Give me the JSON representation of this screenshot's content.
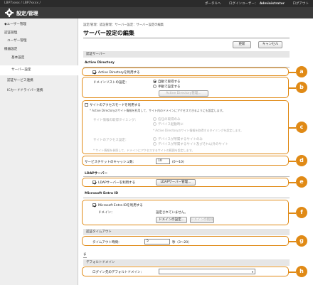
{
  "header": {
    "model": "LBP7xxxx / LBP7xxxx /",
    "links": [
      "ポータルへ",
      "ログインユーザー：",
      "Administrator",
      "ログアウト"
    ],
    "app_title": "設定/管理"
  },
  "sidebar": {
    "items": [
      {
        "label": "◆ユーザー管理"
      },
      {
        "label": "認証管理"
      },
      {
        "label": "ユーザー管理"
      },
      {
        "label": "機器設定"
      },
      {
        "label": "基本設定"
      },
      {
        "label": "サーバー設定"
      },
      {
        "label": "認証サービス連携"
      },
      {
        "label": "ICカードドライバー連携"
      }
    ]
  },
  "main": {
    "breadcrumb": "設定/管理：認証管理：サーバー設定：サーバー設定の編集",
    "page_title": "サーバー設定の編集",
    "update_button": "更新",
    "cancel_button": "キャンセル",
    "auth_server_header": "認証サーバー",
    "ad": {
      "title": "Active Directory",
      "use_ad": "Active Directoryを利用する",
      "domain_list_label": "ドメインリストの設定：",
      "auto_get": "自動で取得する",
      "manual": "手動で設定する",
      "ad_manage_button": "Active Directory管理...",
      "site_access_mode": "サイトのアクセスモードを利用する",
      "site_access_note": "* Active Directoryのサイト情報を利用して、サイト内のドメインにアクセスできるようにも設定します。",
      "site_info_timing_label": "サイト情報の取得タイミング：",
      "timing_opt1": "信任の取得のみ",
      "timing_opt2": "デバイス起動時に",
      "timing_note": "* Active Directoryのサイト情報を取得するタイミングを設定します。",
      "site_access_setting_label": "サイトのアクセス設定：",
      "access_opt1": "デバイスが所属するサイトのみ",
      "access_opt2": "デバイスが所属するサイト及びそれ以外のサイト",
      "access_note": "* サイト情報を参照して、ドメインにアクセスするサイトの範囲を設定します。",
      "ticket_cache_label": "サービスチケットのキャッシュ数：",
      "ticket_cache_value": "10",
      "ticket_cache_range": "(0〜10)"
    },
    "ldap": {
      "title": "LDAPサーバー",
      "use_ldap": "LDAPサーバーを利用する",
      "ldap_manage_button": "LDAPサーバー管理..."
    },
    "entra": {
      "title": "Microsoft Entra ID",
      "use_entra": "Microsoft Entra IDを利用する",
      "domain_label": "ドメイン：",
      "domain_value": "設定されていません。",
      "domain_settings_button": "ドメインの設定...",
      "domain_delete_button": "ドメインの削除"
    },
    "timeout": {
      "header": "認証タイムアウト",
      "label": "タイムアウト時間：",
      "value": "5",
      "range": "秒（3〜20）"
    },
    "default_domain": {
      "small": "ま",
      "header": "デフォルトドメイン",
      "label": "ログイン先のデフォルトドメイン：",
      "value": ""
    }
  },
  "callouts": [
    "a",
    "b",
    "c",
    "d",
    "e",
    "f",
    "g",
    "h"
  ],
  "colors": {
    "callout": "#e08a16",
    "topbar": "#2b2b2b",
    "titlebar": "#3a3a3a"
  }
}
